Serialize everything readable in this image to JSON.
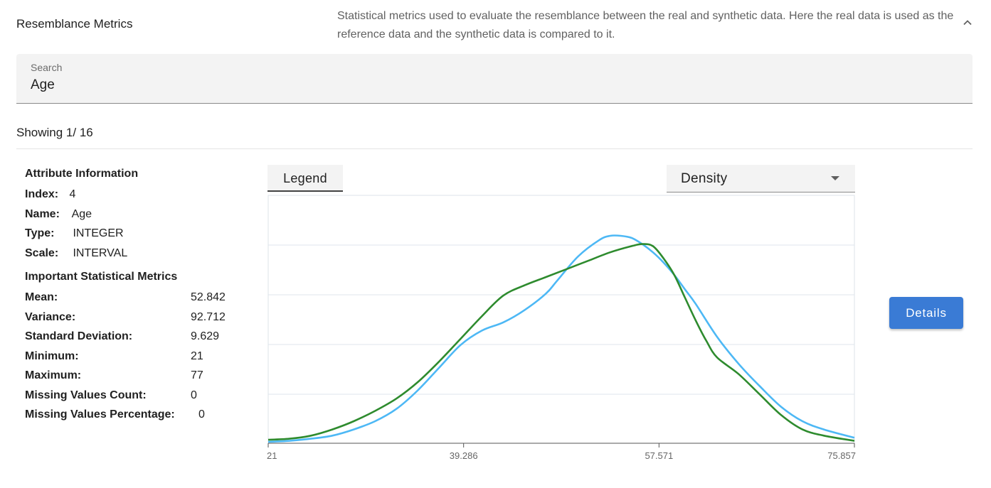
{
  "header": {
    "title": "Resemblance Metrics",
    "description": "Statistical metrics used to evaluate the resemblance between the real and synthetic data. Here the real data is used as the reference data and the synthetic data is compared to it.",
    "collapse_icon": "chevron-up-icon"
  },
  "search": {
    "label": "Search",
    "value": "Age"
  },
  "showing": "Showing 1/ 16",
  "attribute_info": {
    "heading": "Attribute Information",
    "index_label": "Index:",
    "index_value": "4",
    "name_label": "Name:",
    "name_value": "Age",
    "type_label": "Type:",
    "type_value": "INTEGER",
    "scale_label": "Scale:",
    "scale_value": "INTERVAL"
  },
  "metrics": {
    "heading": "Important Statistical Metrics",
    "items": [
      {
        "label": "Mean:",
        "value": "52.842"
      },
      {
        "label": "Variance:",
        "value": "92.712"
      },
      {
        "label": "Standard Deviation:",
        "value": "9.629"
      },
      {
        "label": "Minimum:",
        "value": "21"
      },
      {
        "label": "Maximum:",
        "value": "77"
      },
      {
        "label": "Missing Values Count:",
        "value": "0"
      },
      {
        "label": "Missing Values Percentage:",
        "value": "0"
      }
    ]
  },
  "legend_tab": "Legend",
  "plot_type": {
    "selected": "Density",
    "icon": "caret-down-icon"
  },
  "details_button": "Details",
  "colors": {
    "series_blue": "#4db8f5",
    "series_green": "#2e8b2e",
    "button": "#3a7bd5"
  },
  "chart_data": {
    "type": "line",
    "title": "",
    "xlabel": "",
    "ylabel": "",
    "xlim": [
      21,
      75.857
    ],
    "ylim": [
      0,
      1
    ],
    "x_ticks": [
      "21",
      "39.286",
      "57.571",
      "75.857"
    ],
    "grid": true,
    "y_tick_labels_shown": false,
    "series": [
      {
        "color": "#4db8f5",
        "x": [
          21,
          23,
          25,
          27,
          29,
          31,
          33,
          35,
          37,
          39,
          41,
          43,
          45,
          47,
          48,
          50,
          52,
          53,
          54,
          55,
          56,
          57,
          58,
          59,
          60,
          61,
          63,
          65,
          67,
          69,
          71,
          73,
          75.857
        ],
        "y": [
          0.0,
          0.005,
          0.015,
          0.03,
          0.06,
          0.1,
          0.16,
          0.25,
          0.36,
          0.47,
          0.54,
          0.58,
          0.64,
          0.72,
          0.78,
          0.9,
          0.98,
          1.0,
          1.0,
          0.99,
          0.96,
          0.92,
          0.87,
          0.81,
          0.74,
          0.67,
          0.51,
          0.38,
          0.27,
          0.17,
          0.1,
          0.06,
          0.02
        ]
      },
      {
        "color": "#2e8b2e",
        "x": [
          21,
          23,
          25,
          27,
          29,
          31,
          33,
          35,
          37,
          39,
          41,
          43,
          45,
          47,
          49,
          51,
          53,
          55,
          56,
          57,
          58,
          59,
          60,
          61,
          62,
          63,
          65,
          67,
          69,
          71,
          73,
          75.857
        ],
        "y": [
          0.01,
          0.015,
          0.03,
          0.06,
          0.1,
          0.15,
          0.21,
          0.29,
          0.39,
          0.5,
          0.61,
          0.71,
          0.76,
          0.8,
          0.84,
          0.88,
          0.92,
          0.95,
          0.96,
          0.95,
          0.89,
          0.81,
          0.7,
          0.59,
          0.49,
          0.41,
          0.33,
          0.23,
          0.13,
          0.06,
          0.03,
          0.005
        ]
      }
    ]
  }
}
